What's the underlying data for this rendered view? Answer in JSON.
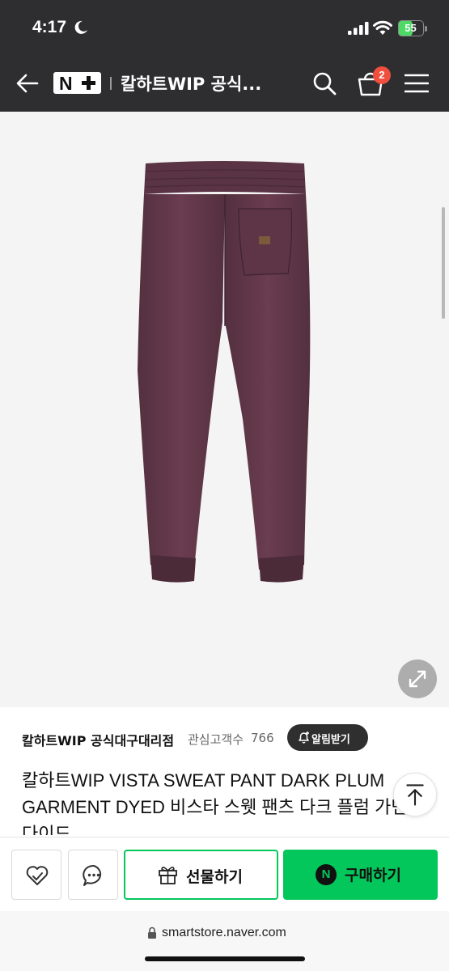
{
  "status_bar": {
    "time": "4:17",
    "battery": "55",
    "battery_fraction": 0.55,
    "icons": [
      "moon-icon",
      "signal-icon",
      "wifi-icon",
      "battery-icon"
    ]
  },
  "header": {
    "back_icon": "back-arrow-icon",
    "logo_text": "N",
    "store_title": "칼하트WIP 공식...",
    "search_icon": "search-icon",
    "cart_icon": "shopping-bag-icon",
    "cart_count": "2",
    "menu_icon": "hamburger-menu-icon"
  },
  "product_image": {
    "expand_icon": "expand-arrows-icon",
    "colors": {
      "pants": "#5e3646",
      "background": "#f4f4f4"
    }
  },
  "store_info": {
    "name": "칼하트WIP 공식대구대리점",
    "followers_label": "관심고객수",
    "followers_count": "766",
    "alert_button": "알림받기"
  },
  "product": {
    "title": "칼하트WIP VISTA SWEAT PANT DARK PLUM GARMENT DYED 비스타 스웻 팬츠 다크 플럼 가먼트 다이드"
  },
  "actions": {
    "wish_icon": "heart-check-icon",
    "talk_icon": "chat-bubble-icon",
    "gift_label": "선물하기",
    "gift_icon": "gift-icon",
    "buy_label": "구매하기",
    "npay_letter": "N",
    "colors": {
      "primary": "#03c75a"
    }
  },
  "browser": {
    "url": "smartstore.naver.com"
  }
}
